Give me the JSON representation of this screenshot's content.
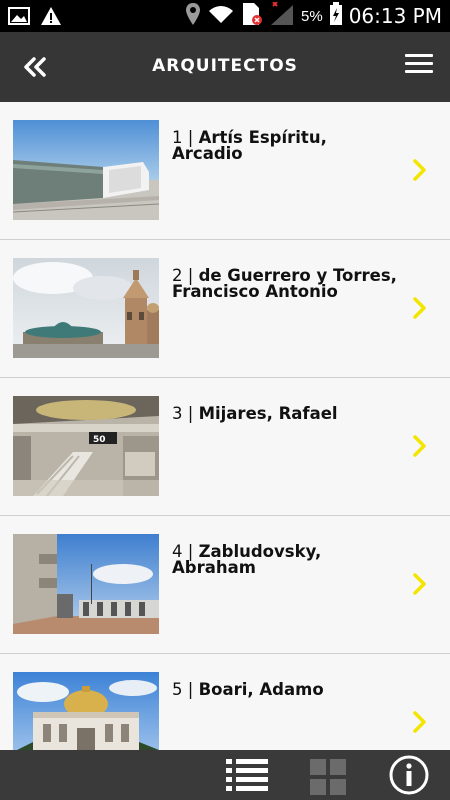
{
  "status_bar": {
    "battery_percent": "5%",
    "time": "06:13 PM",
    "icons": [
      "image-icon",
      "warning-icon",
      "location-icon",
      "wifi-icon",
      "sim-icon",
      "signal-icon",
      "battery-icon"
    ]
  },
  "header": {
    "title": "ARQUITECTOS",
    "back_icon": "double-chevron-left-icon",
    "menu_icon": "hamburger-icon"
  },
  "architects": [
    {
      "number": "1 |",
      "name": "Artís Espíritu, Arcadio"
    },
    {
      "number": "2 |",
      "name": "de Guerrero y Torres, Francisco Antonio"
    },
    {
      "number": "3 |",
      "name": "Mijares, Rafael"
    },
    {
      "number": "4 |",
      "name": "Zabludovsky, Abraham"
    },
    {
      "number": "5 |",
      "name": "Boari, Adamo"
    }
  ],
  "bottom_bar": {
    "icons": [
      "list-view-icon",
      "grid-view-icon",
      "info-icon"
    ]
  },
  "colors": {
    "header_bg": "#363636",
    "accent_chevron": "#f2e500",
    "bottom_bar_bg": "#3a3a3a"
  }
}
